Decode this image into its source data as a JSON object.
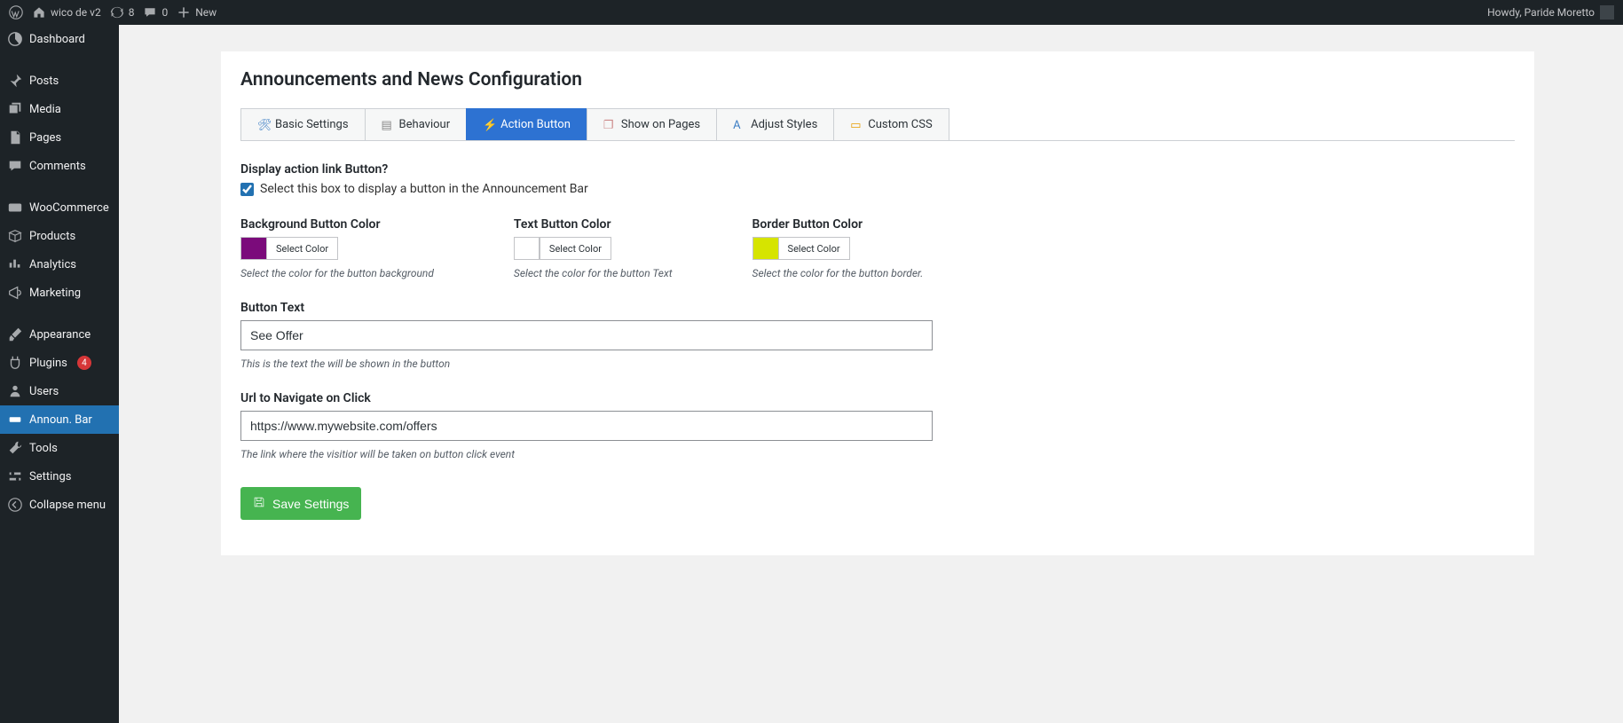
{
  "adminbar": {
    "site_name": "wico de v2",
    "updates_count": "8",
    "comments_count": "0",
    "new_label": "New",
    "greeting": "Howdy, Paride Moretto"
  },
  "sidebar": {
    "items": [
      {
        "label": "Dashboard"
      },
      {
        "label": "Posts"
      },
      {
        "label": "Media"
      },
      {
        "label": "Pages"
      },
      {
        "label": "Comments"
      },
      {
        "label": "WooCommerce"
      },
      {
        "label": "Products"
      },
      {
        "label": "Analytics"
      },
      {
        "label": "Marketing"
      },
      {
        "label": "Appearance"
      },
      {
        "label": "Plugins",
        "badge": "4"
      },
      {
        "label": "Users"
      },
      {
        "label": "Announ. Bar"
      },
      {
        "label": "Tools"
      },
      {
        "label": "Settings"
      },
      {
        "label": "Collapse menu"
      }
    ]
  },
  "page": {
    "title": "Announcements and News Configuration",
    "tabs": [
      {
        "label": "Basic Settings"
      },
      {
        "label": "Behaviour"
      },
      {
        "label": "Action Button"
      },
      {
        "label": "Show on Pages"
      },
      {
        "label": "Adjust Styles"
      },
      {
        "label": "Custom CSS"
      }
    ],
    "display_group": {
      "label": "Display action link Button?",
      "checkbox_label": "Select this box to display a button in the Announcement Bar",
      "checked": true
    },
    "colors": {
      "select_label": "Select Color",
      "bg": {
        "label": "Background Button Color",
        "value": "#7b0b7b",
        "hint": "Select the color for the button background"
      },
      "text": {
        "label": "Text Button Color",
        "value": "#ffffff",
        "hint": "Select the color for the button Text"
      },
      "border": {
        "label": "Border Button Color",
        "value": "#d6e400",
        "hint": "Select the color for the button border."
      }
    },
    "button_text": {
      "label": "Button Text",
      "value": "See Offer",
      "hint": "This is the text the will be shown in the button"
    },
    "url": {
      "label": "Url to Navigate on Click",
      "value": "https://www.mywebsite.com/offers",
      "hint": "The link where the visitior will be taken on button click event"
    },
    "save_label": "Save Settings"
  }
}
